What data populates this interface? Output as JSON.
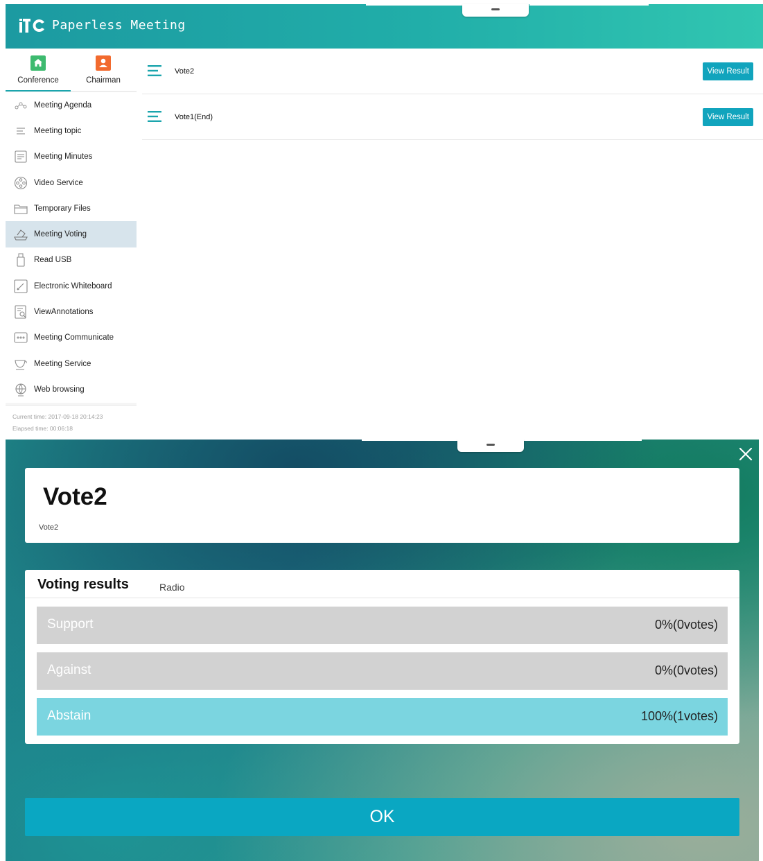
{
  "app": {
    "title": "Paperless Meeting",
    "logo_text": "itC"
  },
  "sidebar": {
    "tabs": [
      {
        "label": "Conference",
        "icon": "home-icon",
        "color": "#3dba6f",
        "active": true
      },
      {
        "label": "Chairman",
        "icon": "person-icon",
        "color": "#f26a2e",
        "active": false
      }
    ],
    "items": [
      {
        "label": "Meeting Agenda",
        "icon": "agenda-icon"
      },
      {
        "label": "Meeting topic",
        "icon": "topic-list-icon"
      },
      {
        "label": "Meeting Minutes",
        "icon": "minutes-icon"
      },
      {
        "label": "Video Service",
        "icon": "film-reel-icon"
      },
      {
        "label": "Temporary Files",
        "icon": "folder-icon"
      },
      {
        "label": "Meeting Voting",
        "icon": "ballot-box-icon",
        "active": true
      },
      {
        "label": "Read USB",
        "icon": "usb-icon"
      },
      {
        "label": "Electronic Whiteboard",
        "icon": "pencil-icon"
      },
      {
        "label": "ViewAnnotations",
        "icon": "document-search-icon"
      },
      {
        "label": "Meeting Communicate",
        "icon": "chat-bubble-icon"
      },
      {
        "label": "Meeting Service",
        "icon": "cup-icon"
      },
      {
        "label": "Web browsing",
        "icon": "globe-icon"
      }
    ],
    "status": {
      "current_time": "Current time:  2017-09-18 20:14:23",
      "elapsed_time": "Elapsed time:  00:06:18"
    }
  },
  "votes": [
    {
      "name": "Vote2",
      "button": "View Result"
    },
    {
      "name": "Vote1(End)",
      "button": "View Result"
    }
  ],
  "dialog": {
    "title": "Vote2",
    "description": "Vote2",
    "results_title": "Voting results",
    "vote_type": "Radio",
    "results": [
      {
        "option": "Support",
        "value": "0%(0votes)",
        "percent": 0
      },
      {
        "option": "Against",
        "value": "0%(0votes)",
        "percent": 0
      },
      {
        "option": "Abstain",
        "value": "100%(1votes)",
        "percent": 100
      }
    ],
    "ok_label": "OK"
  },
  "colors": {
    "accent": "#1ba5ad",
    "button": "#11a4bd",
    "bar_empty": "#d2d2d2",
    "bar_fill": "#7bd5e0"
  }
}
